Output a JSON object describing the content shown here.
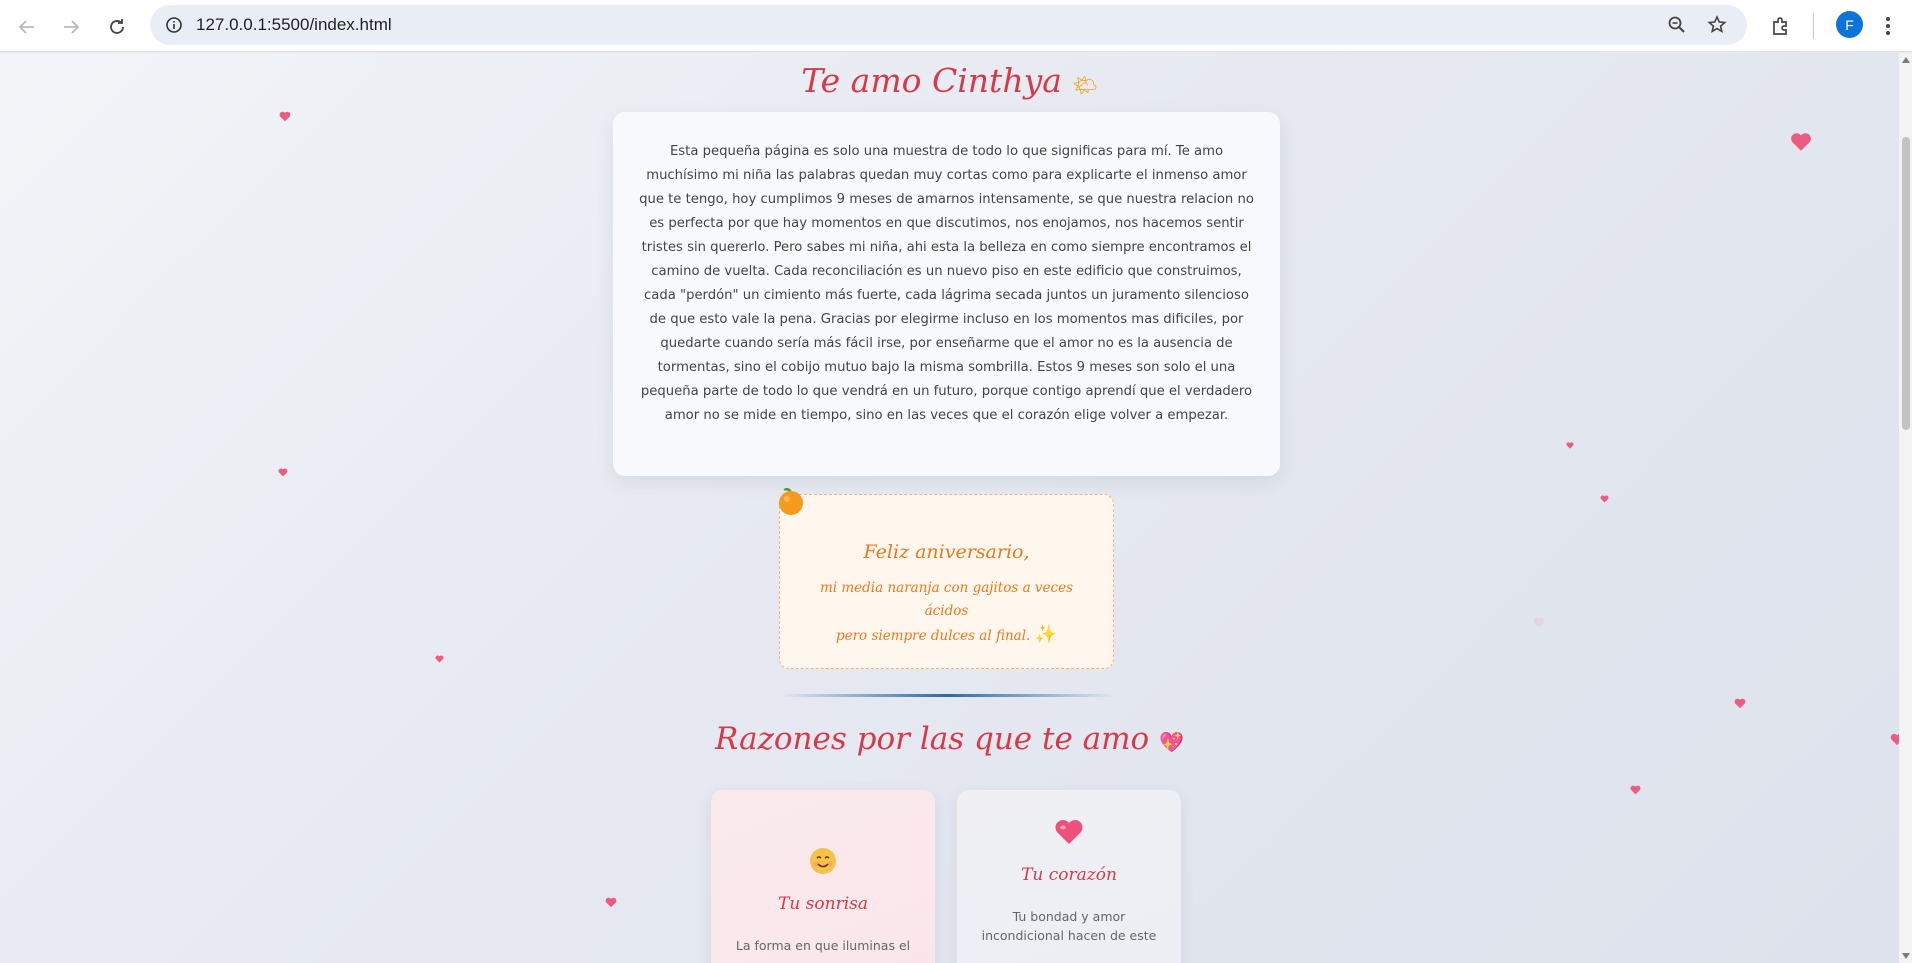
{
  "browser": {
    "url": "127.0.0.1:5500/index.html",
    "profile_initial": "F"
  },
  "hero": {
    "title": "Te amo Cinthya",
    "emoji": "🌤",
    "message": "Esta pequeña página es solo una muestra de todo lo que significas para mí. Te amo muchísimo mi niña las palabras quedan muy cortas como para explicarte el inmenso amor que te tengo, hoy cumplimos 9 meses de amarnos intensamente, se que nuestra relacion no es perfecta por que hay momentos en que discutimos, nos enojamos, nos hacemos sentir tristes sin quererlo. Pero sabes mi niña, ahi esta la belleza en como siempre encontramos el camino de vuelta. Cada reconciliación es un nuevo piso en este edificio que construimos, cada \"perdón\" un cimiento más fuerte, cada lágrima secada juntos un juramento silencioso de que esto vale la pena. Gracias por elegirme incluso en los momentos mas dificiles, por quedarte cuando sería más fácil irse, por enseñarme que el amor no es la ausencia de tormentas, sino el cobijo mutuo bajo la misma sombrilla. Estos 9 meses son solo el una pequeña parte de todo lo que vendrá en un futuro, porque contigo aprendí que el verdadero amor no se mide en tiempo, sino en las veces que el corazón elige volver a empezar."
  },
  "anniversary": {
    "title": "Feliz aniversario,",
    "line1": "mi media naranja con gajitos a veces ácidos",
    "line2": "pero siempre dulces al final.",
    "sparkle": "✨"
  },
  "reasons": {
    "title": "Razones por las que te amo",
    "emoji": "💖",
    "cards": [
      {
        "icon": "smile-icon",
        "title": "Tu sonrisa",
        "text": "La forma en que iluminas el"
      },
      {
        "icon": "heart-icon",
        "title": "Tu corazón",
        "text": "Tu bondad y amor incondicional hacen de este"
      }
    ]
  },
  "colors": {
    "accent_red": "#d63a4a",
    "orange": "#e9791c",
    "heart_pink": "#ec5c82"
  }
}
